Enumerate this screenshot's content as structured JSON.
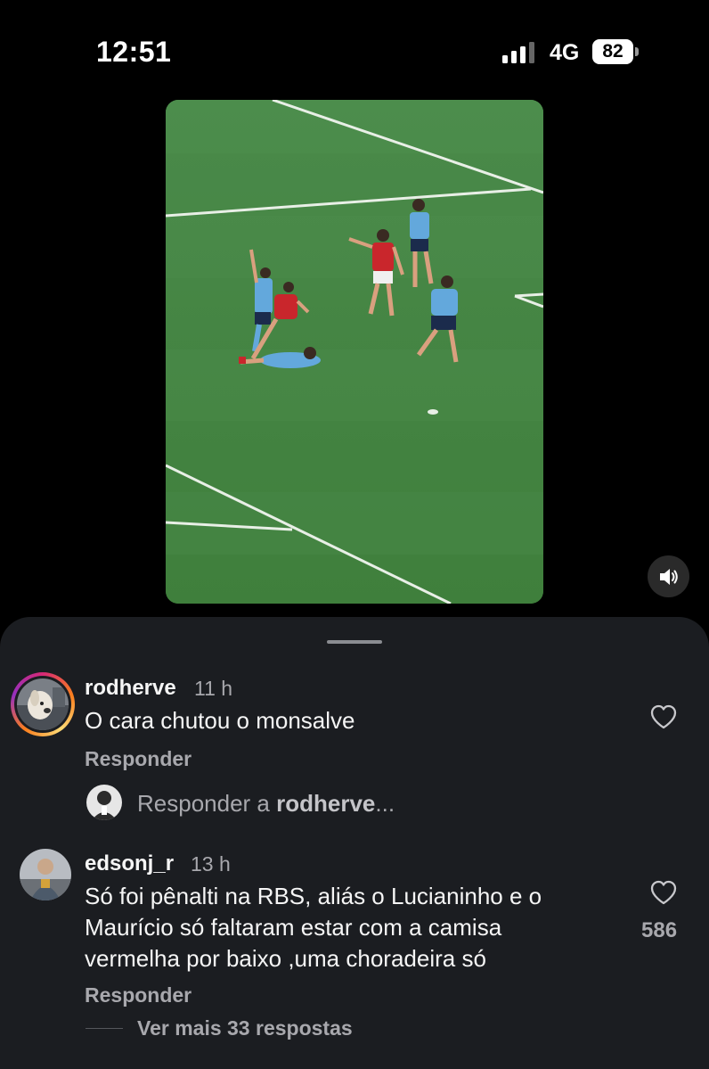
{
  "status_bar": {
    "time": "12:51",
    "network": "4G",
    "battery": "82"
  },
  "video": {
    "icons": {
      "mute": "speaker-icon"
    }
  },
  "comments": [
    {
      "username": "rodherve",
      "time": "11 h",
      "text": "O cara chutou o monsalve",
      "reply_label": "Responder",
      "like_count": ""
    },
    {
      "username": "edsonj_r",
      "time": "13 h",
      "text_lines": [
        "Só foi pênalti na RBS, aliás o Lucianinho e o",
        "Maurício só faltaram estar com a camisa",
        "vermelha por baixo ,uma choradeira só"
      ],
      "reply_label": "Responder",
      "like_count": "586"
    }
  ],
  "reply_box": {
    "prefix": "Responder a",
    "target": "rodherve",
    "suffix": "..."
  },
  "more_replies": "Ver mais 33 respostas",
  "icons": {
    "like": "heart-icon",
    "signal": "signal-bars-icon",
    "battery": "battery-icon"
  }
}
